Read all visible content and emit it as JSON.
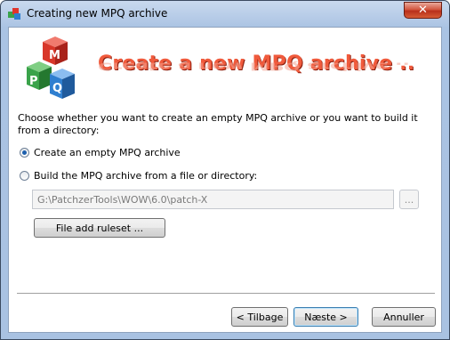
{
  "window": {
    "title": "Creating new MPQ archive",
    "close_glyph": "✕",
    "app_icon": "mpq-app-icon"
  },
  "banner": {
    "title": "Create a new MPQ archive ..",
    "logo_letters": [
      "M",
      "P",
      "Q"
    ],
    "colors": {
      "title": "#f05a3c",
      "cube_red": "#e0352b",
      "cube_green": "#3aa34a",
      "cube_blue": "#2f7fd0"
    }
  },
  "description": "Choose whether you want to create an empty MPQ archive or you want to build it from a directory:",
  "options": {
    "empty_label": "Create an empty MPQ archive",
    "empty_checked": true,
    "build_label": "Build the MPQ archive from a file or directory:",
    "build_checked": false
  },
  "path": {
    "value": "G:\\PatchzerTools\\WOW\\6.0\\patch-X",
    "browse_label": "..."
  },
  "ruleset_button": "File add ruleset ...",
  "footer": {
    "back_label": "< Tilbage",
    "next_label": "Næste >",
    "cancel_label": "Annuller"
  }
}
